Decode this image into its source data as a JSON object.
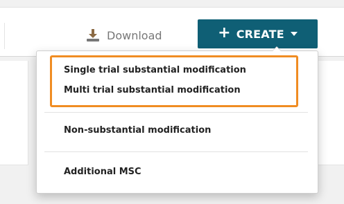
{
  "toolbar": {
    "download_label": "Download",
    "create_label": "CREATE"
  },
  "dropdown": {
    "items": [
      {
        "label": "Single trial substantial modification"
      },
      {
        "label": "Multi trial substantial modification"
      },
      {
        "label": "Non-substantial modification"
      },
      {
        "label": "Additional MSC"
      }
    ]
  },
  "colors": {
    "create_button_bg": "#0f5f75",
    "highlight_border": "#f08c22",
    "page_bg": "#f1f1f1"
  },
  "icons": {
    "download": "download-icon",
    "create_plus": "plus-icon",
    "create_caret": "caret-down-icon"
  }
}
